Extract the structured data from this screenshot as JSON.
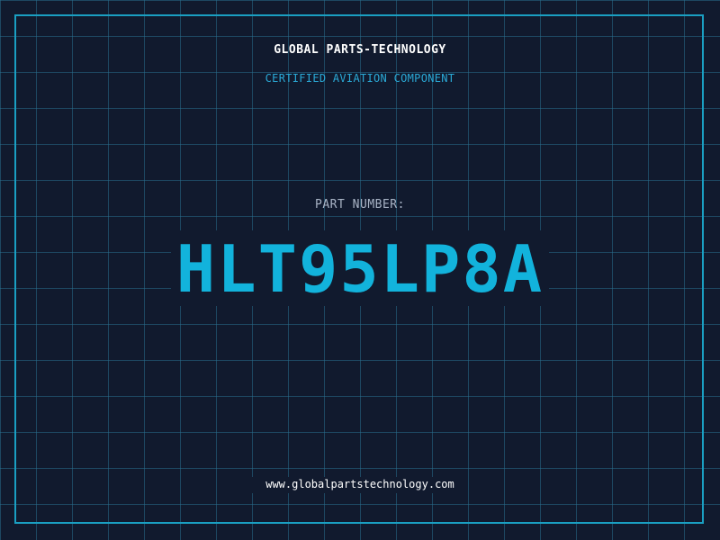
{
  "header": {
    "company": "GLOBAL PARTS-TECHNOLOGY",
    "tagline": "CERTIFIED AVIATION COMPONENT"
  },
  "part": {
    "label": "PART NUMBER:",
    "number": "HLT95LP8A"
  },
  "footer": {
    "url": "www.globalpartstechnology.com"
  },
  "colors": {
    "background": "#111a2e",
    "grid": "#286e8c",
    "frame": "#1a9fc2",
    "accent": "#12b3dc",
    "tagline": "#2aa9d6",
    "label": "#a9b4c6",
    "text": "#ffffff"
  }
}
